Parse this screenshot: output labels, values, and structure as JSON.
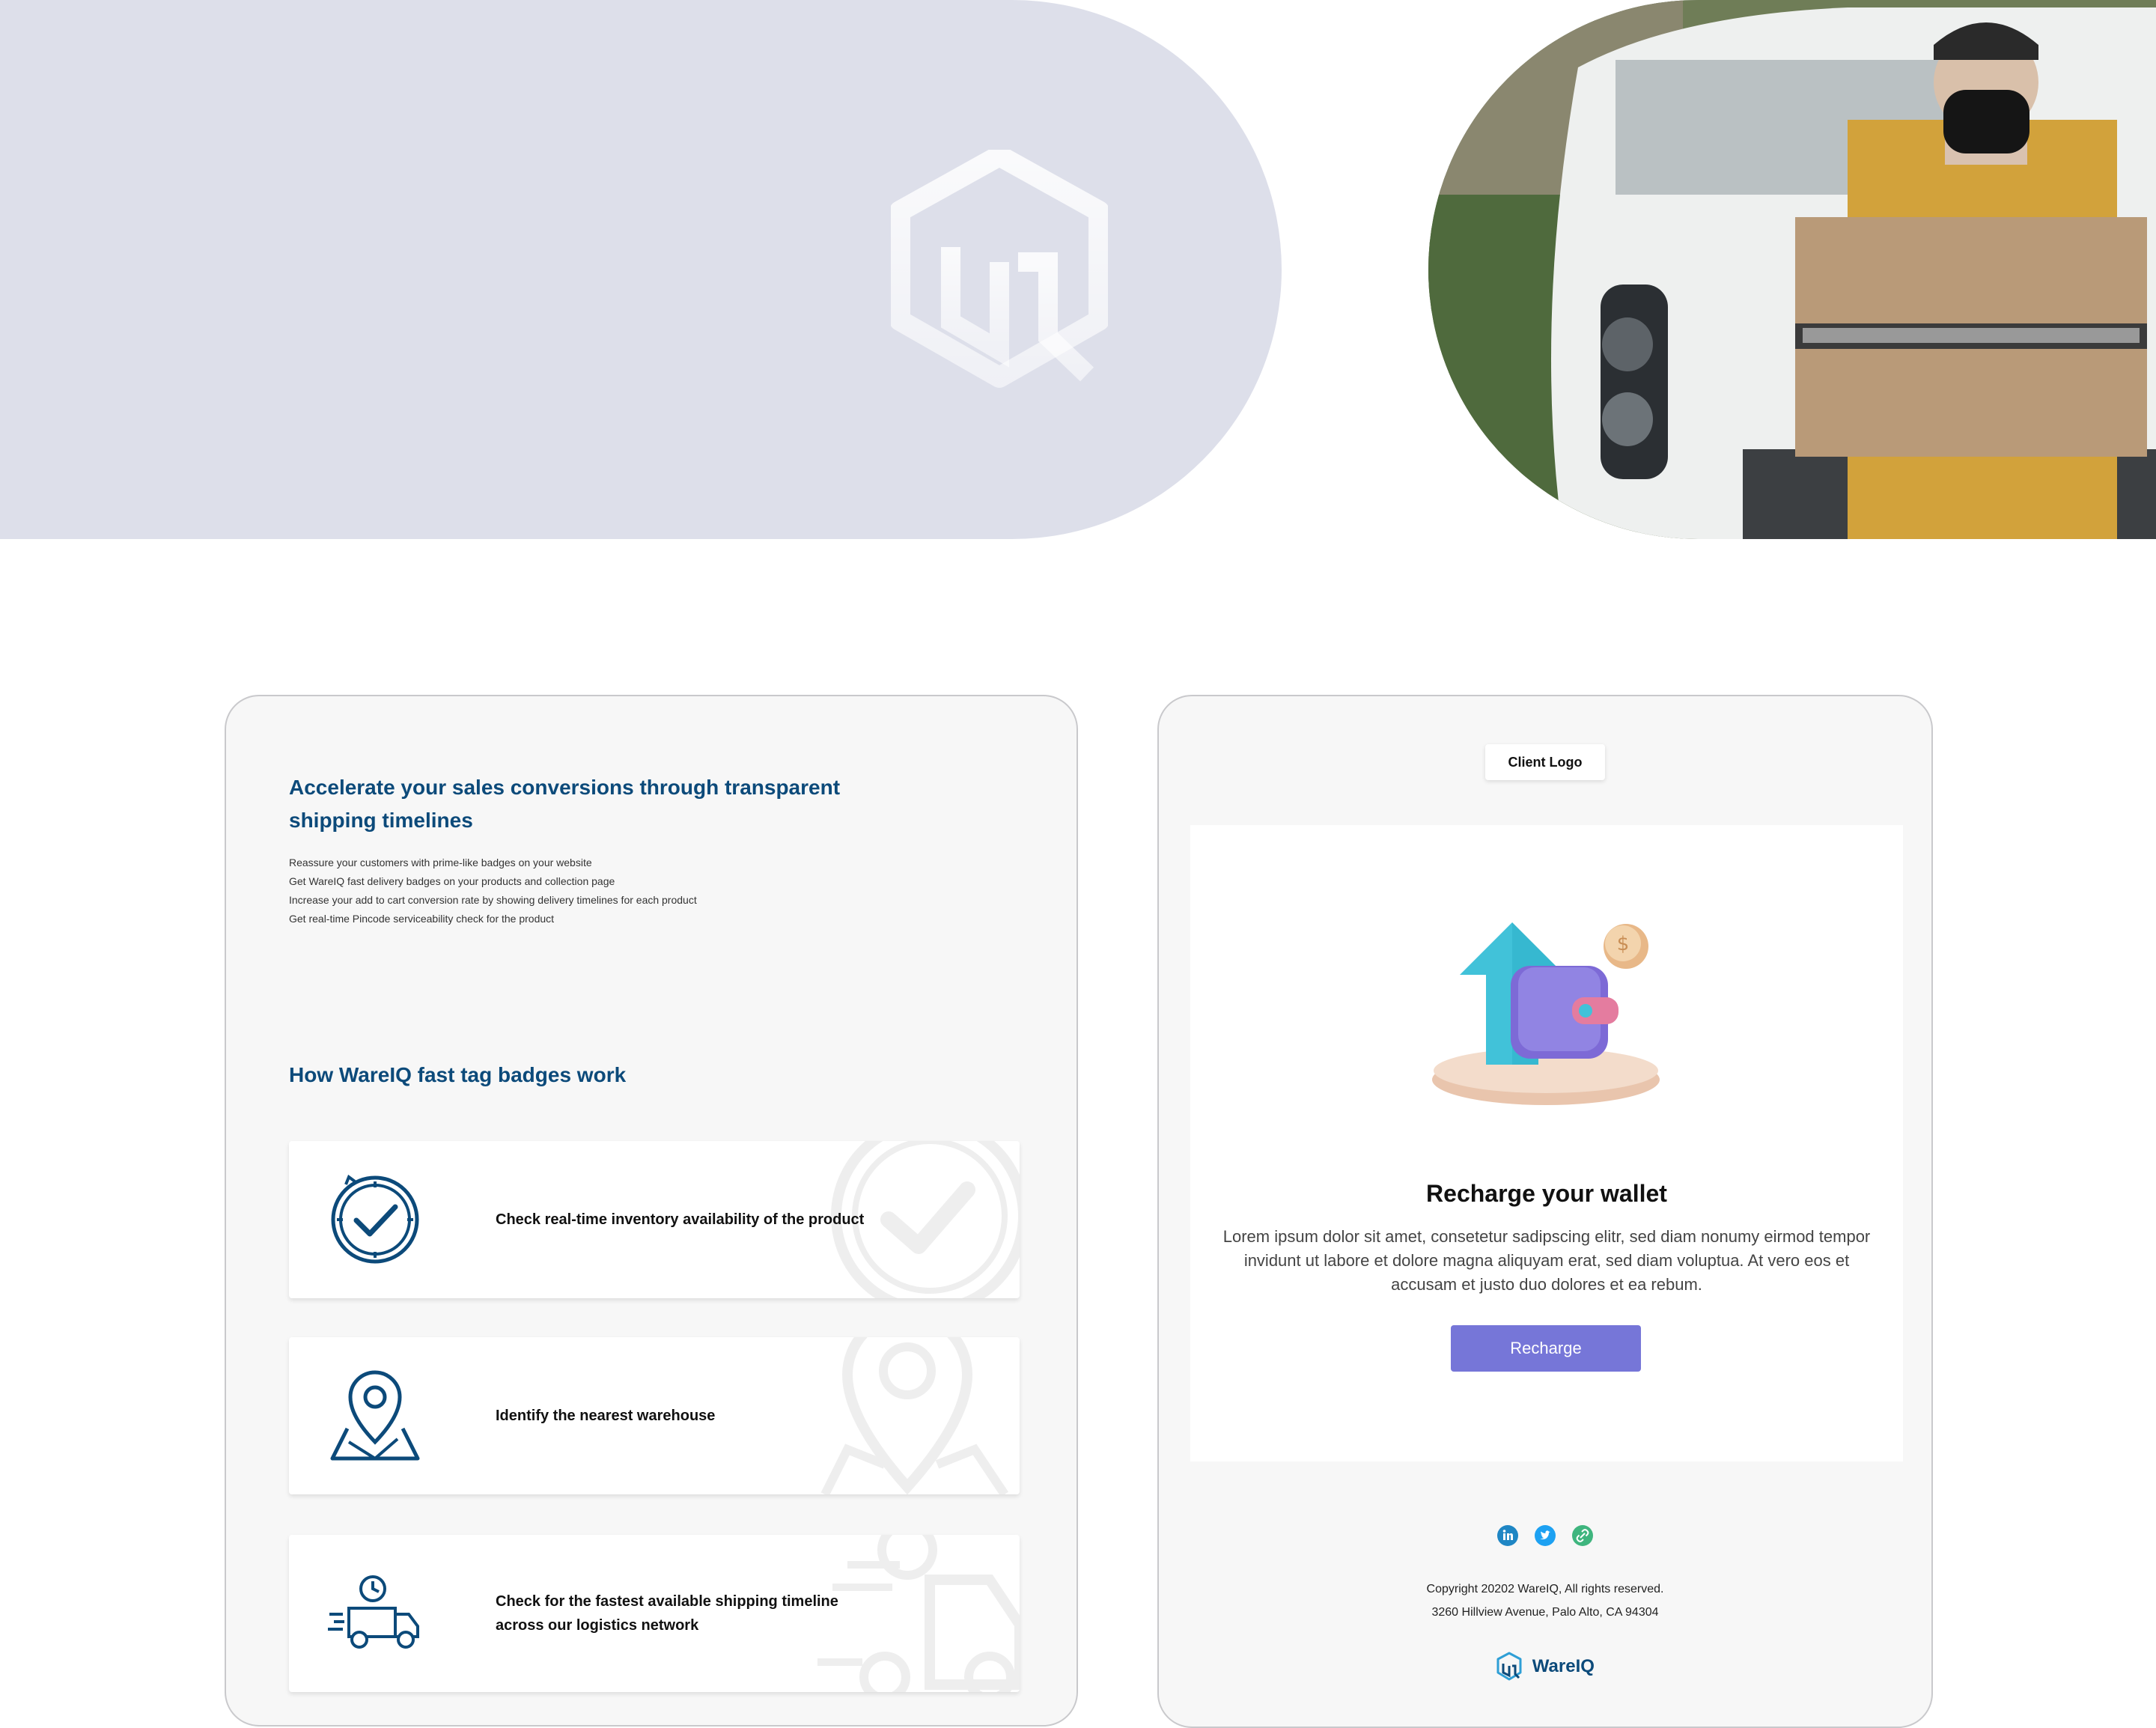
{
  "colors": {
    "brand_blue": "#0c4a7a",
    "accent_purple": "#7676d8",
    "hero_bg": "#dddfea",
    "card_bg": "#f7f7f7"
  },
  "hero": {
    "logo_icon": "wareiq-box-logo-icon",
    "photo": "delivery-man-with-box-photo"
  },
  "left_panel": {
    "title": "Accelerate your sales conversions through transparent shipping timelines",
    "bullets": [
      "Reassure your customers with prime-like badges on your website",
      "Get WareIQ fast delivery badges on your products and collection page",
      "Increase your add to cart conversion rate by showing delivery timelines for each product",
      "Get real-time Pincode serviceability check for the product"
    ],
    "subtitle": "How WareIQ fast tag badges work",
    "features": [
      {
        "icon": "clock-check-icon",
        "text": "Check real-time inventory availability of the product"
      },
      {
        "icon": "location-pin-map-icon",
        "text": "Identify the nearest warehouse"
      },
      {
        "icon": "delivery-truck-icon",
        "text": "Check for the fastest available shipping timeline across our logistics network"
      }
    ]
  },
  "right_panel": {
    "client_logo": "Client Logo",
    "illustration": "wallet-recharge-illustration",
    "heading": "Recharge your wallet",
    "body": "Lorem ipsum dolor sit amet, consetetur sadipscing elitr, sed diam nonumy eirmod tempor invidunt ut labore et dolore magna aliquyam erat, sed diam voluptua. At vero eos et accusam et justo duo dolores et ea rebum.",
    "button_label": "Recharge",
    "socials": [
      "linkedin-icon",
      "twitter-icon",
      "link-icon"
    ],
    "copyright": "Copyright 20202 WareIQ, All rights reserved.",
    "address": "3260 Hillview Avenue, Palo Alto, CA 94304",
    "brand_name": "WareIQ"
  }
}
